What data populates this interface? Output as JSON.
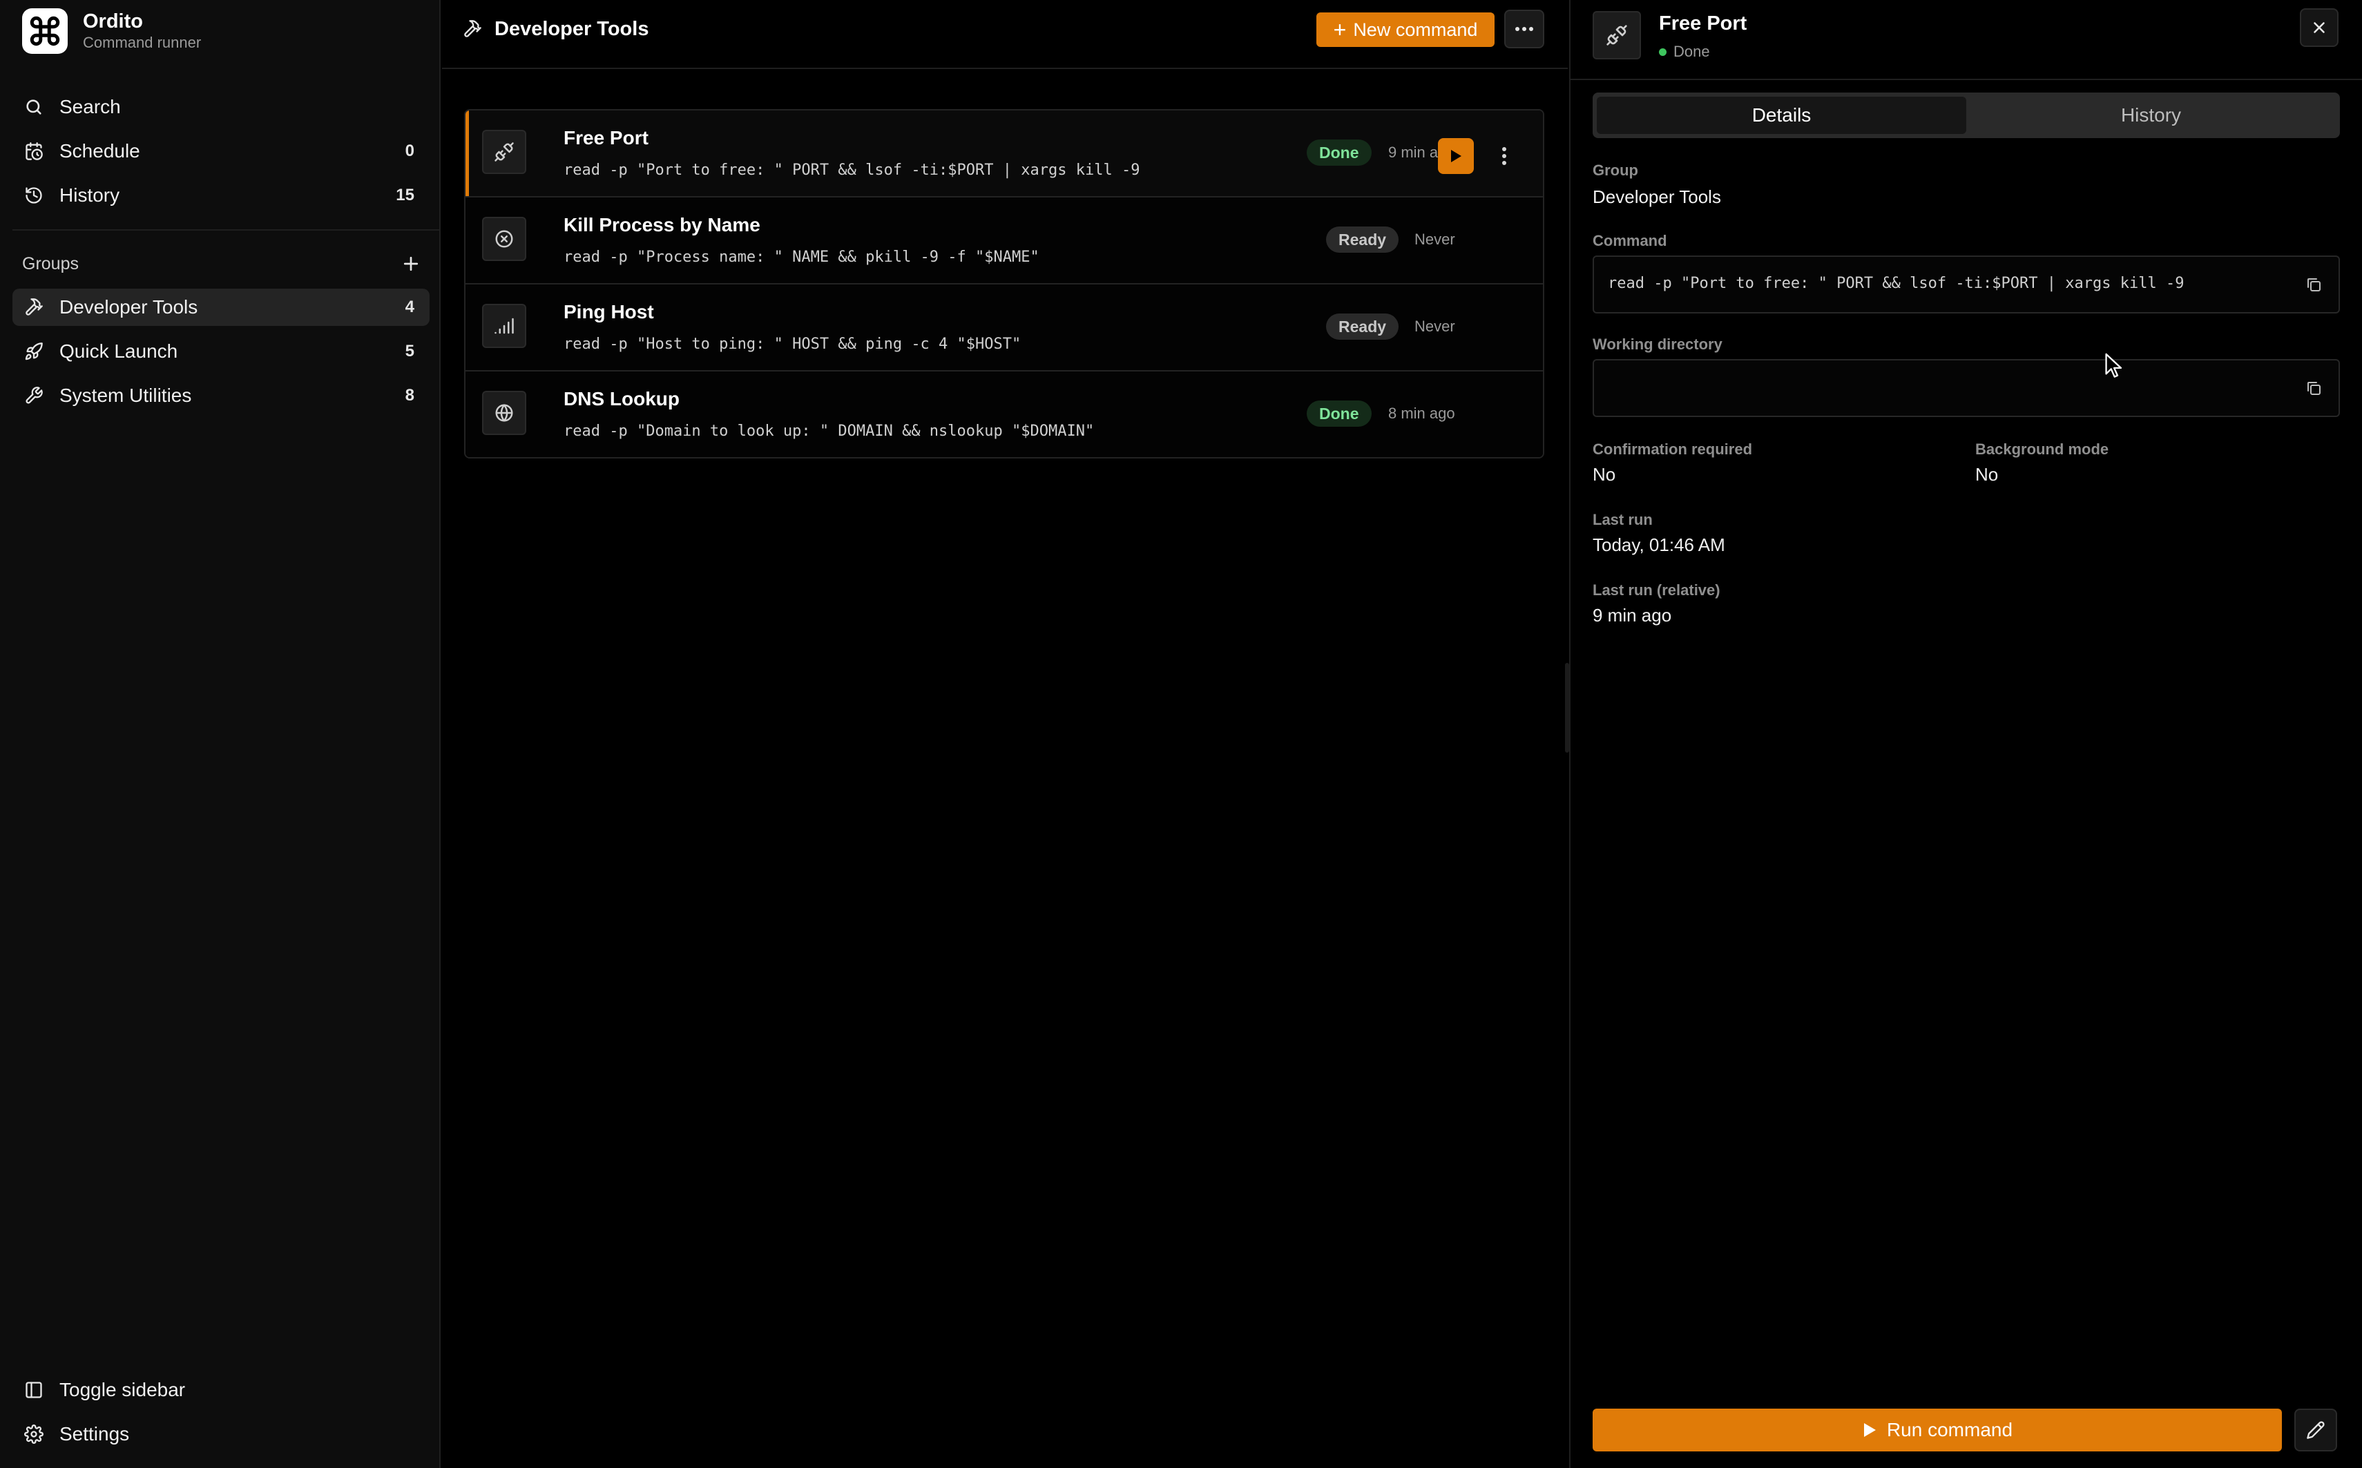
{
  "app": {
    "name": "Ordito",
    "subtitle": "Command runner"
  },
  "colors": {
    "accent": "#e07b08",
    "done_bg": "#142b19",
    "done_text": "#7fe39a",
    "ready_bg": "#2a2a2a",
    "status_dot": "#3ec55e"
  },
  "sidebar": {
    "nav": [
      {
        "label": "Search",
        "icon": "search-icon",
        "count": ""
      },
      {
        "label": "Schedule",
        "icon": "calendar-clock-icon",
        "count": "0"
      },
      {
        "label": "History",
        "icon": "history-icon",
        "count": "15"
      }
    ],
    "groups_label": "Groups",
    "groups": [
      {
        "label": "Developer Tools",
        "icon": "hammer-icon",
        "count": "4",
        "active": true
      },
      {
        "label": "Quick Launch",
        "icon": "rocket-icon",
        "count": "5",
        "active": false
      },
      {
        "label": "System Utilities",
        "icon": "wrench-icon",
        "count": "8",
        "active": false
      }
    ],
    "footer": [
      {
        "label": "Toggle sidebar",
        "icon": "sidebar-toggle-icon"
      },
      {
        "label": "Settings",
        "icon": "gear-icon"
      }
    ]
  },
  "main": {
    "title": "Developer Tools",
    "new_command_label": "New command",
    "commands": [
      {
        "name": "Free Port",
        "command": "read -p \"Port to free: \" PORT && lsof -ti:$PORT | xargs kill -9",
        "status": "Done",
        "last_run": "9 min ago",
        "icon": "plug-icon",
        "selected": true
      },
      {
        "name": "Kill Process by Name",
        "command": "read -p \"Process name: \" NAME && pkill -9 -f \"$NAME\"",
        "status": "Ready",
        "last_run": "Never",
        "icon": "circle-x-icon",
        "selected": false
      },
      {
        "name": "Ping Host",
        "command": "read -p \"Host to ping: \" HOST && ping -c 4 \"$HOST\"",
        "status": "Ready",
        "last_run": "Never",
        "icon": "signal-icon",
        "selected": false
      },
      {
        "name": "DNS Lookup",
        "command": "read -p \"Domain to look up: \" DOMAIN && nslookup \"$DOMAIN\"",
        "status": "Done",
        "last_run": "8 min ago",
        "icon": "globe-icon",
        "selected": false
      }
    ]
  },
  "detail": {
    "title": "Free Port",
    "status": "Done",
    "tabs": [
      "Details",
      "History"
    ],
    "active_tab": "Details",
    "group_label": "Group",
    "group_value": "Developer Tools",
    "command_label": "Command",
    "command_value": "read -p \"Port to free: \" PORT && lsof -ti:$PORT | xargs kill -9",
    "workdir_label": "Working directory",
    "workdir_value": "",
    "confirm_label": "Confirmation required",
    "confirm_value": "No",
    "background_label": "Background mode",
    "background_value": "No",
    "last_run_label": "Last run",
    "last_run_value": "Today, 01:46 AM",
    "last_run_rel_label": "Last run (relative)",
    "last_run_rel_value": "9 min ago",
    "run_label": "Run command"
  }
}
